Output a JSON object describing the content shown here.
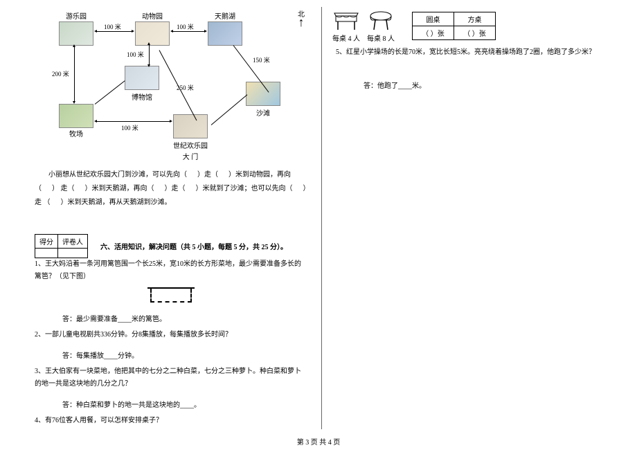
{
  "compass": {
    "north": "北"
  },
  "map": {
    "spots": {
      "amusement_park": "游乐园",
      "zoo": "动物园",
      "swan_lake": "天鹅湖",
      "farm": "牧场",
      "museum": "博物馆",
      "century_gate": "世纪欢乐园",
      "century_gate2": "大 门",
      "beach": "沙滩"
    },
    "distances": {
      "d100": "100 米",
      "d150": "150 米",
      "d200": "200 米",
      "d250": "250 米"
    }
  },
  "map_paragraph": {
    "pre": "小丽想从世纪欢乐园大门到沙滩，可以先向（",
    "seg1": "）走（",
    "seg2": "）米到动物园，再向（",
    "seg3": "）",
    "seg4": "走（",
    "seg5": "）米到天鹅湖，再向（",
    "seg6": "）走（",
    "seg7": "）米就到了沙滩；也可以先向（",
    "seg8": "）走",
    "seg9": "（",
    "seg10": "）米到天鹅湖，再从天鹅湖到沙滩。"
  },
  "score_table": {
    "score": "得分",
    "grader": "评卷人"
  },
  "section6_title": "六、活用知识，解决问题（共 5 小题，每题 5 分，共 25 分）。",
  "q1": {
    "text": "1、王大妈沿着一条河用篱笆围一个长25米，宽10米的长方形菜地，最少需要准备多长的篱笆？（见下图）",
    "answer": "答：最少需要准备____米的篱笆。"
  },
  "q2": {
    "text": "2、一部儿童电视剧共336分钟。分8集播放，每集播放多长时间？",
    "answer": "答：每集播放____分钟。"
  },
  "q3": {
    "text": "3、王大伯家有一块菜地，他把其中的七分之二种白菜，七分之三种萝卜。种白菜和萝卜的地一共是这块地的几分之几？",
    "answer": "答：种白菜和萝卜的地一共是这块地的____。"
  },
  "q4": {
    "text": "4、有76位客人用餐，可以怎样安排桌子？"
  },
  "tables_info": {
    "square_label": "每桌 4 人",
    "round_label": "每桌 8 人",
    "header_round": "圆桌",
    "header_square": "方桌",
    "unit_round": "（        ）张",
    "unit_square": "（        ）张"
  },
  "q5": {
    "text": "5、红星小学操场的长是70米，宽比长短5米。亮亮绕着操场跑了2圈，他跑了多少米？",
    "answer": "答：他跑了____米。"
  },
  "footer": "第 3 页  共 4 页"
}
